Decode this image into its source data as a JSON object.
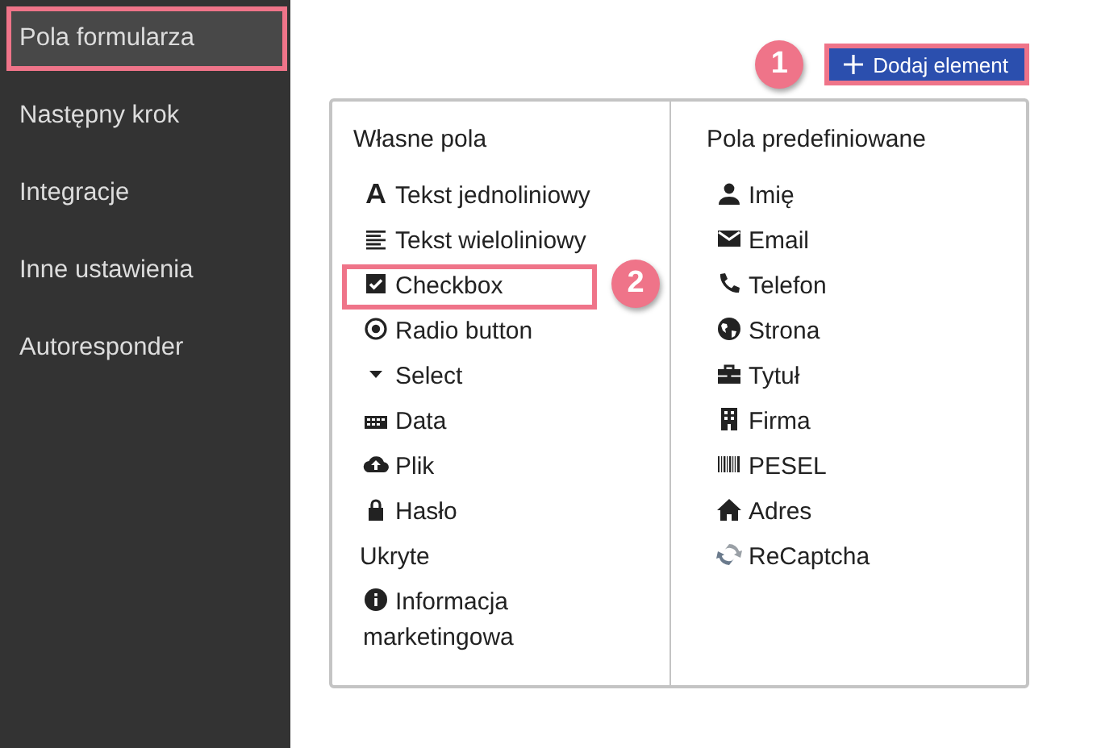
{
  "sidebar": {
    "items": [
      {
        "label": "Pola formularza",
        "selected": true,
        "highlighted": true
      },
      {
        "label": "Następny krok",
        "selected": false,
        "highlighted": false
      },
      {
        "label": "Integracje",
        "selected": false,
        "highlighted": false
      },
      {
        "label": "Inne ustawienia",
        "selected": false,
        "highlighted": false
      },
      {
        "label": "Autoresponder",
        "selected": false,
        "highlighted": false
      }
    ]
  },
  "toolbar": {
    "callout": "1",
    "add_button": {
      "label": "Dodaj element",
      "highlighted": true
    }
  },
  "fields": {
    "columns": [
      {
        "title": "Własne pola",
        "items": [
          {
            "label": "Tekst jednoliniowy",
            "highlighted": false
          },
          {
            "label": "Tekst wieloliniowy",
            "highlighted": false
          },
          {
            "label": "Checkbox",
            "highlighted": true,
            "callout": "2"
          },
          {
            "label": "Radio button",
            "highlighted": false
          },
          {
            "label": "Select",
            "highlighted": false
          },
          {
            "label": "Data",
            "highlighted": false
          },
          {
            "label": "Plik",
            "highlighted": false
          },
          {
            "label": "Hasło",
            "highlighted": false
          },
          {
            "label": "Ukryte",
            "highlighted": false
          },
          {
            "label": "Informacja marketingowa",
            "highlighted": false
          }
        ]
      },
      {
        "title": "Pola predefiniowane",
        "items": [
          {
            "label": "Imię",
            "highlighted": false
          },
          {
            "label": "Email",
            "highlighted": false
          },
          {
            "label": "Telefon",
            "highlighted": false
          },
          {
            "label": "Strona",
            "highlighted": false
          },
          {
            "label": "Tytuł",
            "highlighted": false
          },
          {
            "label": "Firma",
            "highlighted": false
          },
          {
            "label": "PESEL",
            "highlighted": false
          },
          {
            "label": "Adres",
            "highlighted": false
          },
          {
            "label": "ReCaptcha",
            "highlighted": false
          }
        ]
      }
    ]
  }
}
